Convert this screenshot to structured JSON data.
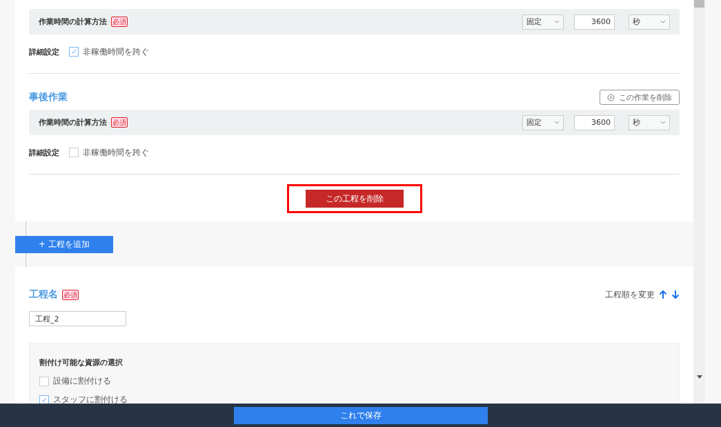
{
  "process_1": {
    "tasks": [
      {
        "calc_label": "作業時間の計算方法",
        "required_badge": "必須",
        "method": "固定",
        "duration": "3600",
        "unit": "秒",
        "details_label": "詳細設定",
        "skip_label": "非稼働時間を跨ぐ",
        "skip_checked": true
      },
      {
        "title": "事後作業",
        "remove_button": "この作業を削除",
        "calc_label": "作業時間の計算方法",
        "required_badge": "必須",
        "method": "固定",
        "duration": "3600",
        "unit": "秒",
        "details_label": "詳細設定",
        "skip_label": "非稼働時間を跨ぐ",
        "skip_checked": false
      }
    ],
    "delete_button": "この工程を削除",
    "delete_highlighted": true
  },
  "add_button": "+ 工程を追加",
  "process_2": {
    "name_label": "工程名",
    "required_badge": "必須",
    "name_value": "工程_2",
    "reorder_label": "工程順を変更",
    "resources": {
      "title": "割付け可能な資源の選択",
      "options": [
        {
          "label": "設備に割付ける",
          "checked": false
        },
        {
          "label": "スタッフに割付ける",
          "checked": true
        }
      ]
    }
  },
  "footer": {
    "save_button": "これで保存"
  }
}
